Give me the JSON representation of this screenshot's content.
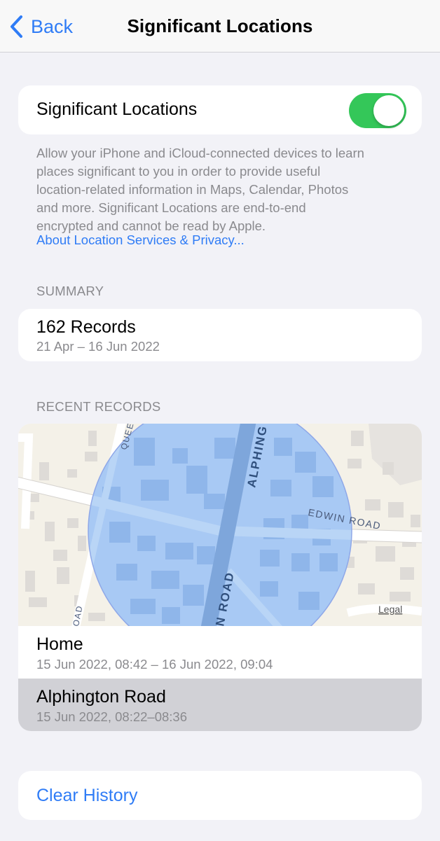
{
  "nav": {
    "back_label": "Back",
    "title": "Significant Locations"
  },
  "toggle": {
    "label": "Significant Locations",
    "state": "on",
    "on_color": "#34c759"
  },
  "footer": {
    "line1": "Allow your iPhone and iCloud-connected devices to learn",
    "line2": "places significant to you in order to provide useful",
    "line3": "location-related information in Maps, Calendar, Photos",
    "line4": "and more. Significant Locations are end-to-end",
    "line5": "encrypted and cannot be read by Apple.",
    "link": "About Location Services & Privacy..."
  },
  "summary": {
    "header": "SUMMARY",
    "title": "162 Records",
    "range": "21 Apr – 16 Jun 2022"
  },
  "recent": {
    "header": "RECENT RECORDS",
    "map": {
      "street_main": "ALPHING",
      "street_main_bottom": "N ROAD",
      "street_right": "EDWIN ROAD",
      "street_top_left": "QUEE",
      "street_left": "OAD",
      "legal": "Legal"
    },
    "items": [
      {
        "title": "Home",
        "time": "15 Jun 2022, 08:42 – 16 Jun 2022, 09:04"
      },
      {
        "title": "Alphington Road",
        "time": "15 Jun 2022, 08:22–08:36"
      }
    ]
  },
  "clear": {
    "label": "Clear History"
  },
  "colors": {
    "accent": "#2f7cf6",
    "background": "#f2f2f7",
    "secondary_text": "#8a8a8e",
    "selected_row": "#d1d1d6",
    "map_circle": "#a8c9f4"
  }
}
